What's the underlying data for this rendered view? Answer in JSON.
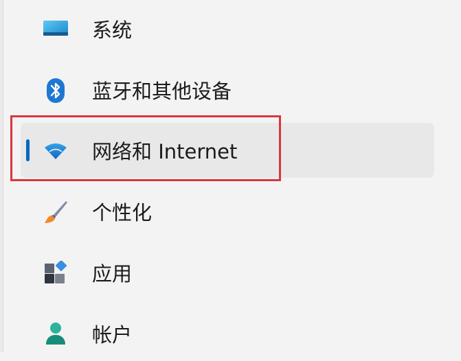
{
  "nav": {
    "items": [
      {
        "label": "系统",
        "icon": "system-display-icon"
      },
      {
        "label": "蓝牙和其他设备",
        "icon": "bluetooth-icon"
      },
      {
        "label": "网络和 Internet",
        "icon": "wifi-icon",
        "selected": true
      },
      {
        "label": "个性化",
        "icon": "paint-brush-icon"
      },
      {
        "label": "应用",
        "icon": "apps-icon"
      },
      {
        "label": "帐户",
        "icon": "account-person-icon"
      }
    ]
  },
  "colors": {
    "accent": "#0067c0",
    "highlight_border": "#d9363e",
    "selected_background": "#e8e8e8",
    "page_background": "#f3f3f3"
  }
}
